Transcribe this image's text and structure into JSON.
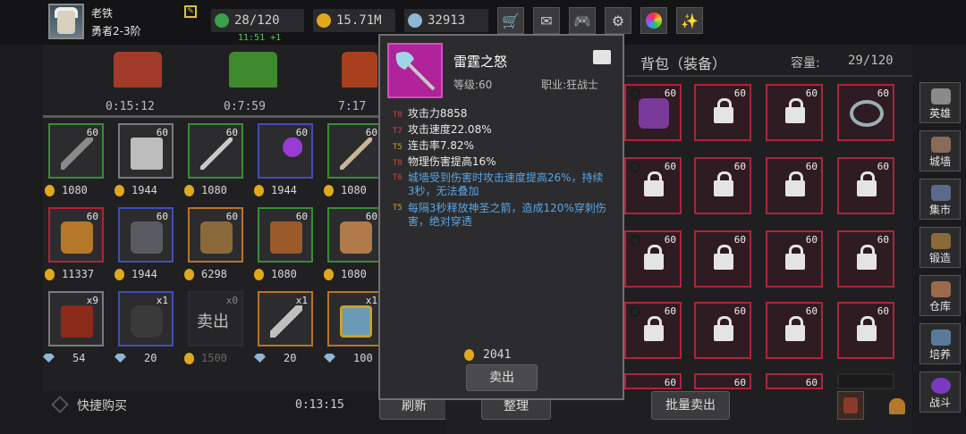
{
  "player": {
    "name": "老铁",
    "rank": "勇者2-3阶"
  },
  "resources": {
    "energy": "28/120",
    "energy_timer": "11:51 +1",
    "gold": "15.71M",
    "gems": "32913"
  },
  "shop": {
    "chests": [
      {
        "timer": "0:15:12",
        "color": "#a23b2a"
      },
      {
        "timer": "0:7:59",
        "color": "#3f8a2e"
      },
      {
        "timer": "7:17",
        "color": "#a8401d"
      }
    ],
    "rows": [
      [
        {
          "count": "60",
          "price": "1080",
          "border": "#3b8a3b",
          "currency": "coin"
        },
        {
          "count": "60",
          "price": "1944",
          "border": "#7b7b7b",
          "currency": "coin"
        },
        {
          "count": "60",
          "price": "1080",
          "border": "#3b8a3b",
          "currency": "coin"
        },
        {
          "count": "60",
          "price": "1944",
          "border": "#3f4fb5",
          "currency": "coin"
        },
        {
          "count": "60",
          "price": "1080",
          "border": "#3b8a3b",
          "currency": "coin"
        }
      ],
      [
        {
          "count": "60",
          "price": "11337",
          "border": "#b2223a",
          "currency": "coin"
        },
        {
          "count": "60",
          "price": "1944",
          "border": "#3f4fb5",
          "currency": "coin"
        },
        {
          "count": "60",
          "price": "6298",
          "border": "#b5752a",
          "currency": "coin"
        },
        {
          "count": "60",
          "price": "1080",
          "border": "#3b8a3b",
          "currency": "coin"
        },
        {
          "count": "60",
          "price": "1080",
          "border": "#3b8a3b",
          "currency": "coin"
        }
      ],
      [
        {
          "count": "x9",
          "price": "54",
          "border": "#7b7b7b",
          "currency": "gem"
        },
        {
          "count": "x1",
          "price": "20",
          "border": "#3f4fb5",
          "currency": "gem"
        },
        {
          "count": "x0",
          "price": "1500",
          "border": "#2c2c2e",
          "currency": "coin",
          "label": "卖出"
        },
        {
          "count": "x1",
          "price": "20",
          "border": "#b5752a",
          "currency": "gem"
        },
        {
          "count": "x1",
          "price": "100",
          "border": "#b5752a",
          "currency": "gem"
        }
      ]
    ],
    "quick_buy": "快捷购买",
    "refresh_timer": "0:13:15",
    "refresh": "刷新"
  },
  "bag": {
    "title": "背包（装备）",
    "capacity_label": "容量:",
    "capacity": "29/120",
    "level": "60",
    "organize": "整理",
    "bulk_sell": "批量卖出"
  },
  "side_menu": [
    "英雄",
    "城墙",
    "集市",
    "锻造",
    "仓库",
    "培养",
    "战斗"
  ],
  "popup": {
    "item_name": "雷霆之怒",
    "level": "等级:60",
    "class": "职业:狂战士",
    "stats": [
      {
        "tier": "T8",
        "text": "攻击力8858",
        "special": false
      },
      {
        "tier": "T7",
        "text": "攻击速度22.08%",
        "special": false
      },
      {
        "tier": "T5",
        "text": "连击率7.82%",
        "special": false
      },
      {
        "tier": "T8",
        "text": "物理伤害提高16%",
        "special": false
      },
      {
        "tier": "T6",
        "text": "城墙受到伤害时攻击速度提高26%，持续3秒，无法叠加",
        "special": true
      },
      {
        "tier": "T5",
        "text": "每隔3秒释放神圣之箭，造成120%穿刺伤害，绝对穿透",
        "special": true
      }
    ],
    "price": "2041",
    "sell_button": "卖出"
  }
}
